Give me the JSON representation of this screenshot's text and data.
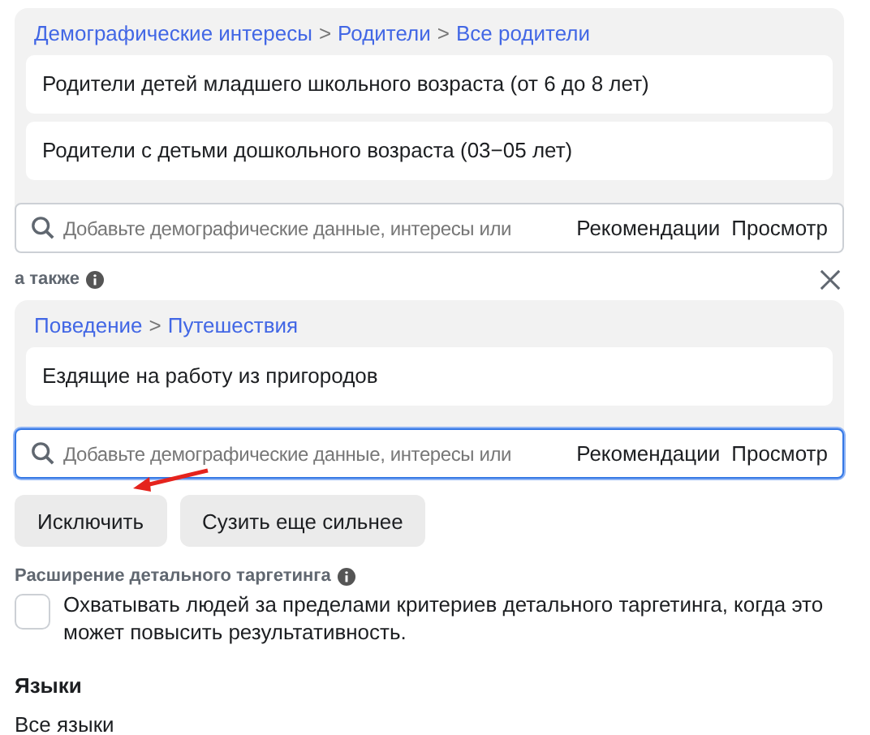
{
  "groups": [
    {
      "breadcrumb": [
        {
          "kind": "link",
          "label": "Демографические интересы"
        },
        {
          "kind": "separator",
          "label": ">"
        },
        {
          "kind": "link",
          "label": "Родители"
        },
        {
          "kind": "separator",
          "label": ">"
        },
        {
          "kind": "link",
          "label": "Все родители"
        }
      ],
      "items": [
        "Родители детей младшего школьного возраста (от 6 до 8 лет)",
        "Родители с детьми дошкольного возраста (03−05 лет)"
      ],
      "search": {
        "placeholder": "Добавьте демографические данные, интересы или",
        "focused": false,
        "links": [
          "Рекомендации",
          "Просмотр"
        ]
      }
    },
    {
      "connector": "а также",
      "closable": true,
      "breadcrumb": [
        {
          "kind": "link",
          "label": "Поведение"
        },
        {
          "kind": "separator",
          "label": ">"
        },
        {
          "kind": "link",
          "label": "Путешествия"
        }
      ],
      "items": [
        "Ездящие на работу из пригородов"
      ],
      "search": {
        "placeholder": "Добавьте демографические данные, интересы или",
        "focused": true,
        "links": [
          "Рекомендации",
          "Просмотр"
        ]
      }
    }
  ],
  "buttons": [
    "Исключить",
    "Сузить еще сильнее"
  ],
  "expansion": {
    "title": "Расширение детального таргетинга",
    "checked": false,
    "label": "Охватывать людей за пределами критериев детального таргетинга, когда это может повысить результативность."
  },
  "languages": {
    "title": "Языки",
    "value": "Все языки"
  }
}
